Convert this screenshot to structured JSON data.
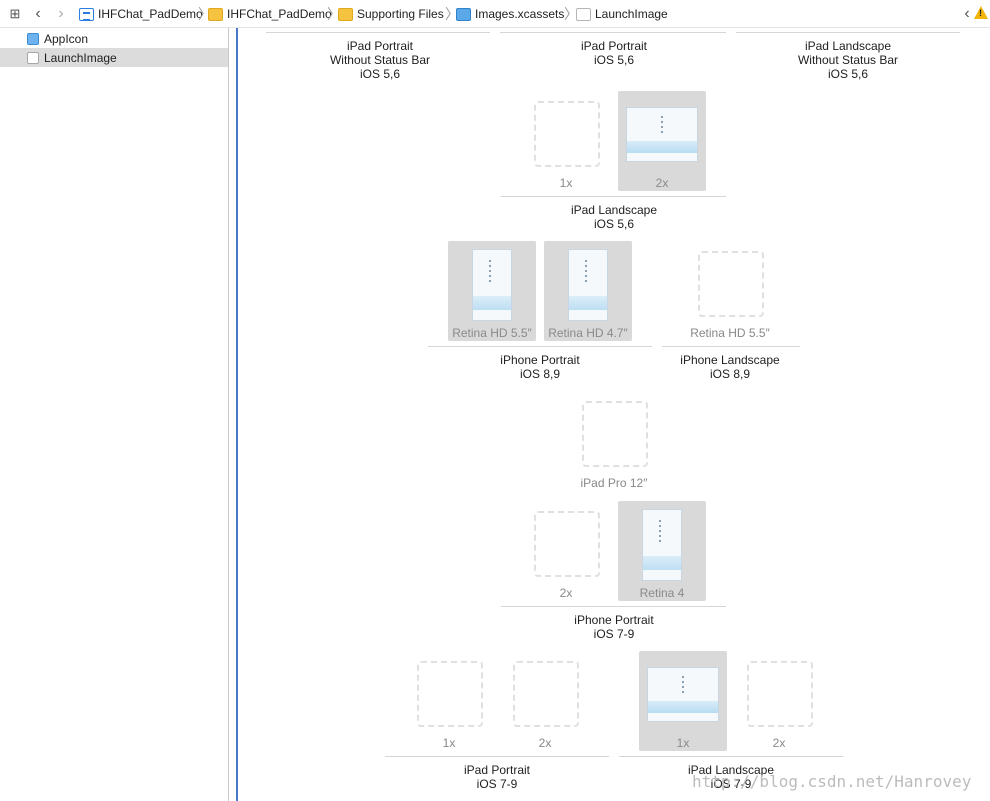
{
  "jumpbar": {
    "crumbs": [
      {
        "label": "IHFChat_PadDemo",
        "icon": "project-icon"
      },
      {
        "label": "IHFChat_PadDemo",
        "icon": "folder-icon"
      },
      {
        "label": "Supporting Files",
        "icon": "folder-icon"
      },
      {
        "label": "Images.xcassets",
        "icon": "asset-catalog-icon"
      },
      {
        "label": "LaunchImage",
        "icon": "launch-image-icon"
      }
    ]
  },
  "sidebar": {
    "items": [
      {
        "label": "AppIcon",
        "selected": false
      },
      {
        "label": "LaunchImage",
        "selected": true
      }
    ]
  },
  "groups": {
    "top_left": {
      "line1": "iPad Portrait",
      "line2": "Without Status Bar",
      "line3": "iOS 5,6"
    },
    "top_mid": {
      "line1": "iPad Portrait",
      "line2": "iOS 5,6"
    },
    "top_right": {
      "line1": "iPad Landscape",
      "line2": "Without Status Bar",
      "line3": "iOS 5,6"
    },
    "ipad_landscape_56": {
      "line1": "iPad Landscape",
      "line2": "iOS 5,6",
      "slots": [
        "1x",
        "2x"
      ]
    },
    "iphone_portrait_89": {
      "line1": "iPhone Portrait",
      "line2": "iOS 8,9",
      "slots": [
        "Retina HD 5.5″",
        "Retina HD 4.7″"
      ]
    },
    "iphone_landscape_89": {
      "line1": "iPhone Landscape",
      "line2": "iOS 8,9",
      "slots": [
        "Retina HD 5.5″"
      ]
    },
    "ipad_pro": {
      "slots": [
        "iPad Pro 12″"
      ]
    },
    "iphone_portrait_79": {
      "line1": "iPhone Portrait",
      "line2": "iOS 7-9",
      "slots": [
        "2x",
        "Retina 4"
      ]
    },
    "ipad_portrait_79": {
      "line1": "iPad Portrait",
      "line2": "iOS 7-9",
      "slots": [
        "1x",
        "2x"
      ]
    },
    "ipad_landscape_79": {
      "line1": "iPad Landscape",
      "line2": "iOS 7-9",
      "slots": [
        "1x",
        "2x"
      ]
    }
  },
  "watermark": "http://blog.csdn.net/Hanrovey"
}
